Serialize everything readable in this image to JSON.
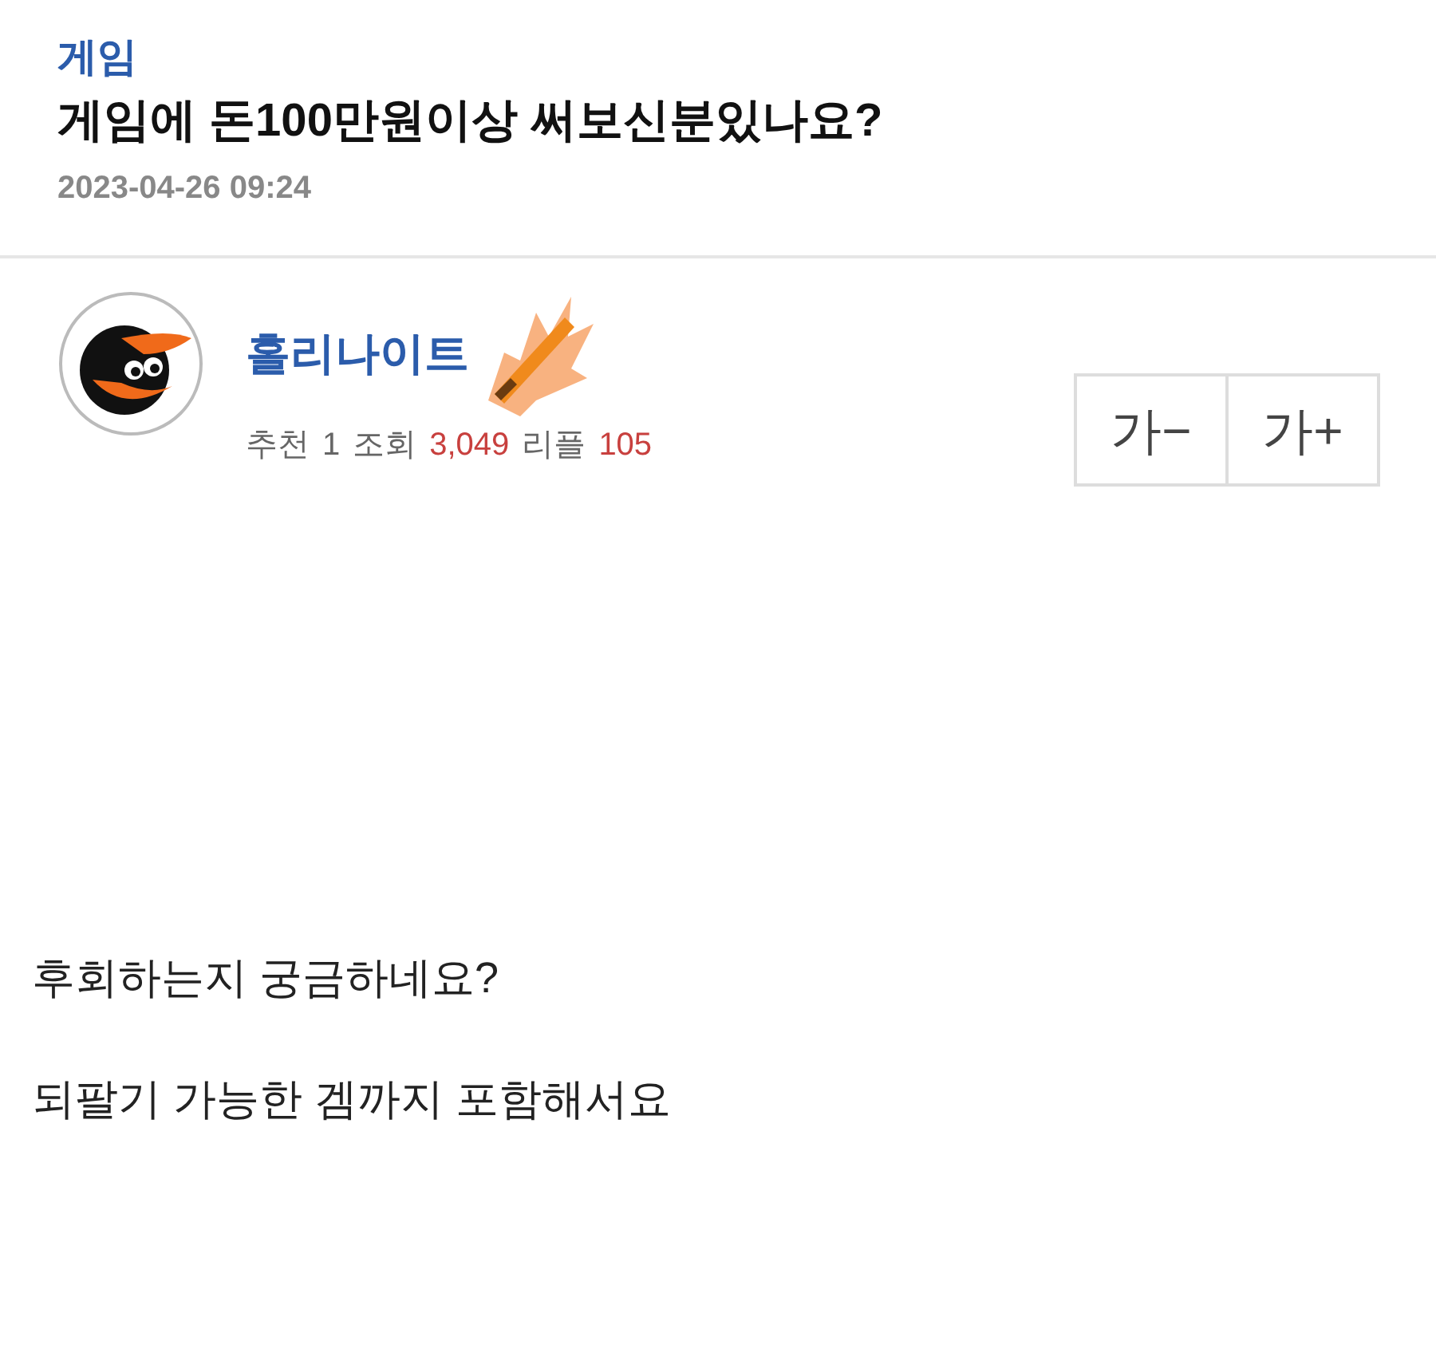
{
  "category": "게임",
  "title": "게임에 돈100만원이상 써보신분있나요?",
  "date": "2023-04-26 09:24",
  "author": {
    "nickname": "홀리나이트"
  },
  "stats": [
    {
      "label": "추천",
      "value": "1",
      "highlight": false
    },
    {
      "label": "조회",
      "value": "3,049",
      "highlight": true
    },
    {
      "label": "리플",
      "value": "105",
      "highlight": true
    }
  ],
  "font_buttons": [
    "가−",
    "가+"
  ],
  "body": [
    "후회하는지 궁금하네요?",
    "되팔기 가능한 겜까지 포함해서요"
  ]
}
